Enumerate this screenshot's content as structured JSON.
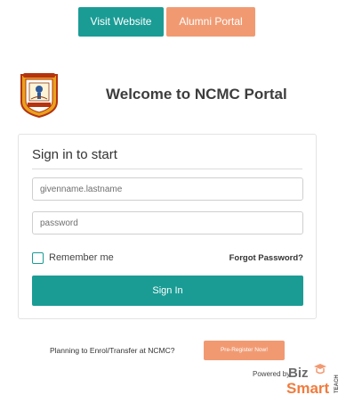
{
  "top_nav": {
    "visit_label": "Visit Website",
    "alumni_label": "Alumni Portal"
  },
  "header": {
    "welcome": "Welcome to NCMC Portal",
    "logo_icon": "ncmc-crest-icon"
  },
  "login": {
    "title": "Sign in to start",
    "username_placeholder": "givenname.lastname",
    "username_value": "",
    "password_placeholder": "password",
    "password_value": "",
    "remember_label": "Remember me",
    "remember_checked": false,
    "forgot_label": "Forgot Password?",
    "signin_label": "Sign In"
  },
  "footer": {
    "prereg_text": "Planning to Enrol/Transfer at NCMC?",
    "prereg_button": "Pre-Register Now!",
    "powered_by": "Powered by",
    "brand_logo_text": "BizSmart TEACH"
  },
  "colors": {
    "teal": "#1a9c95",
    "orange": "#f19a72"
  }
}
